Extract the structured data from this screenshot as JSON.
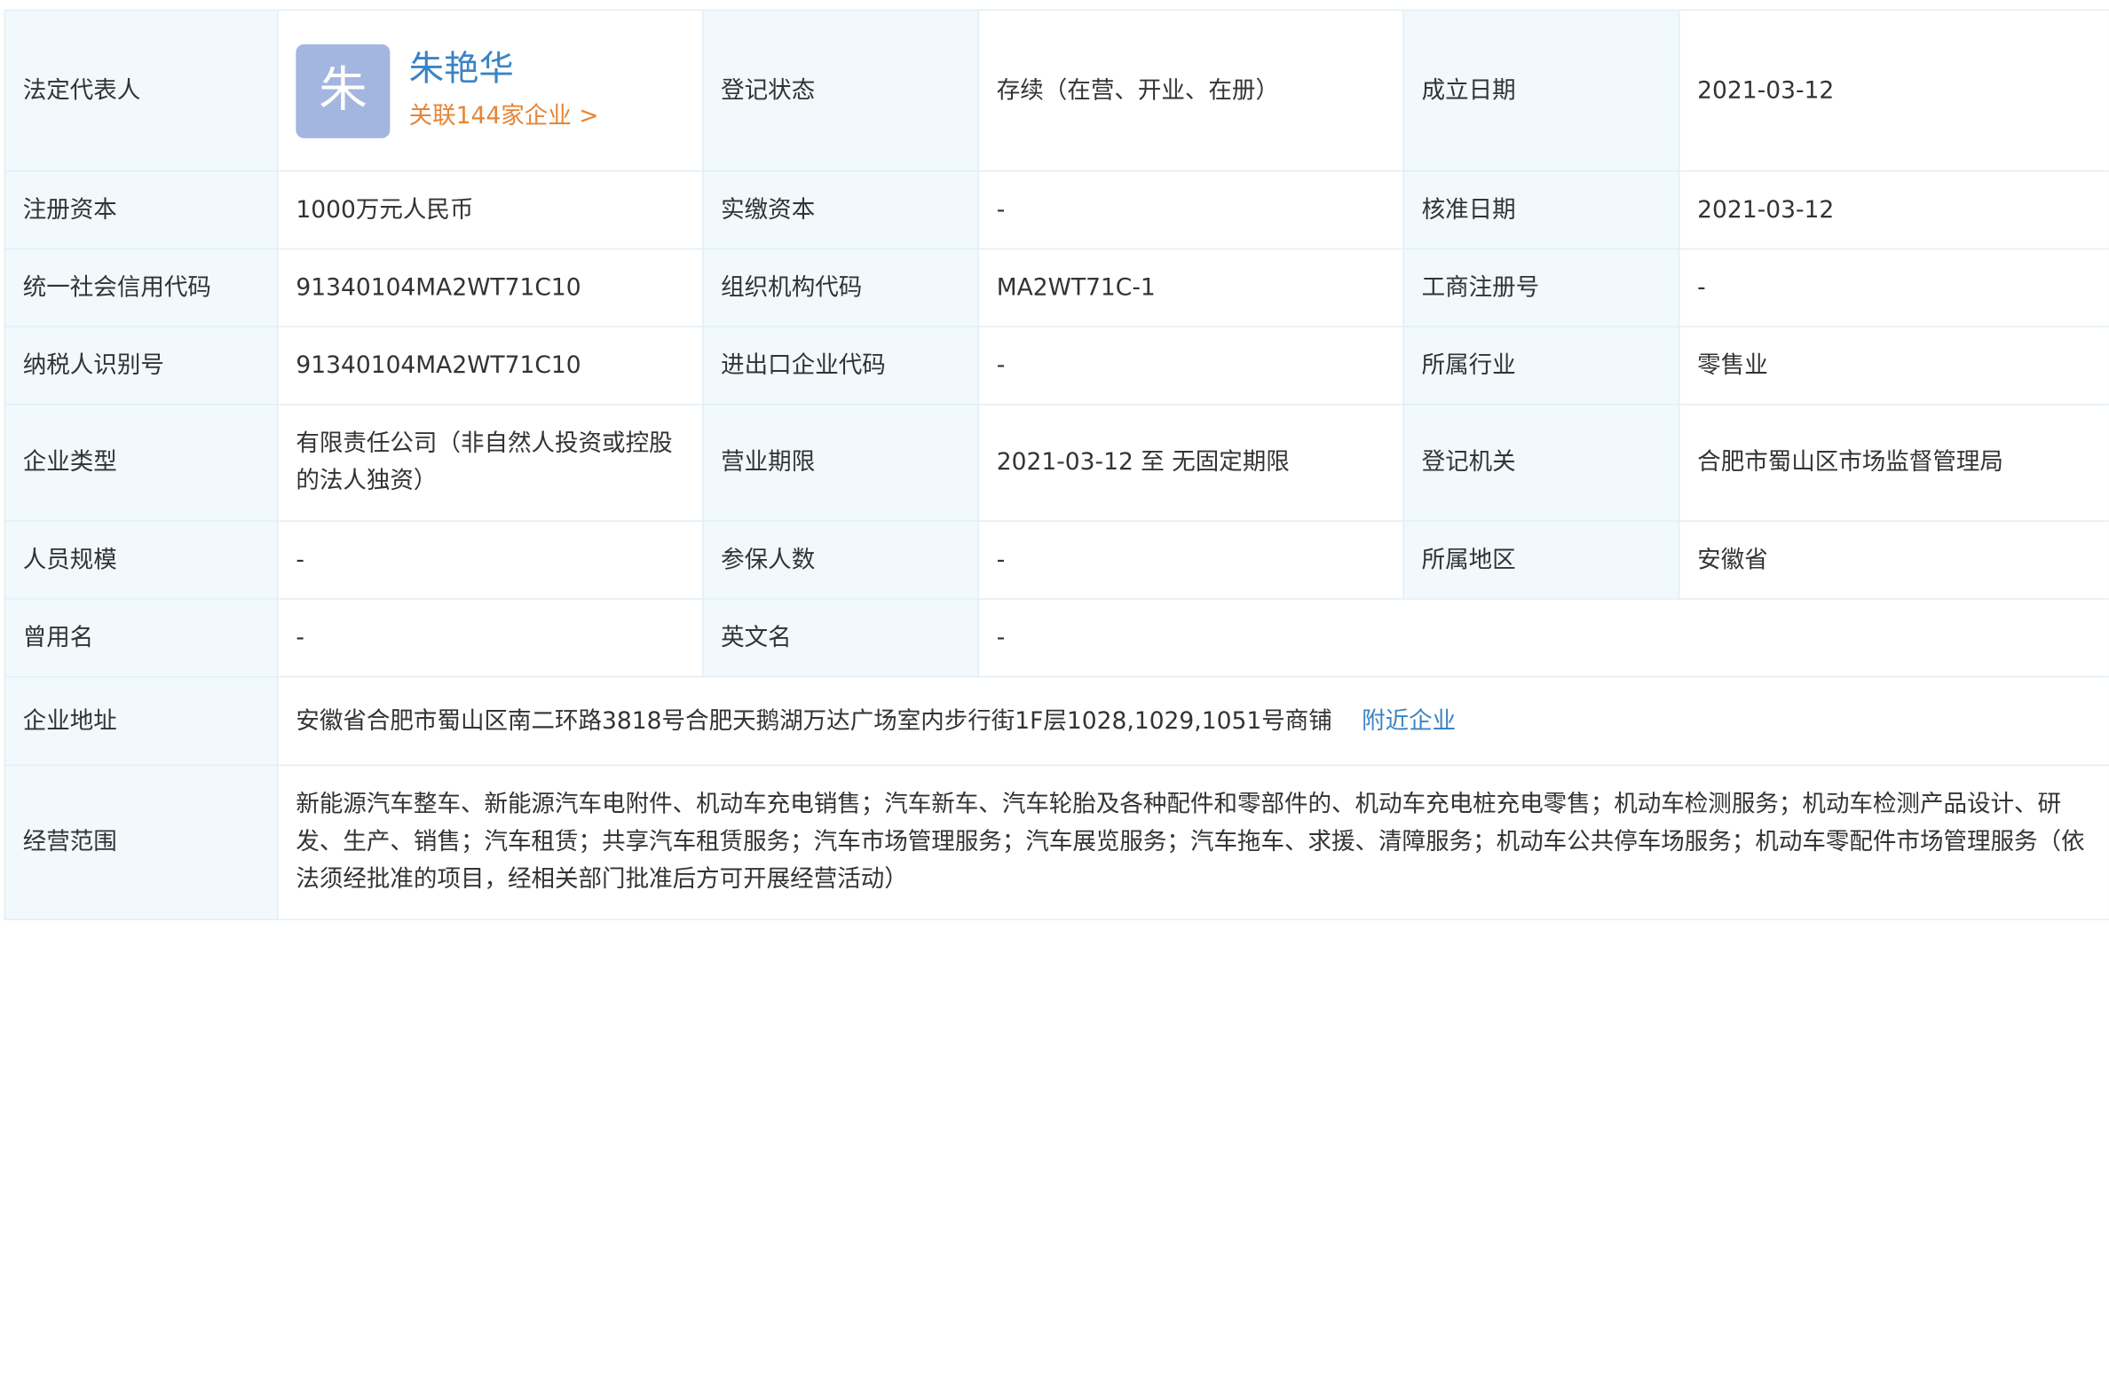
{
  "legal_rep": {
    "label": "法定代表人",
    "avatar_char": "朱",
    "name": "朱艳华",
    "related_link": "关联144家企业 >",
    "avatar_color": "#a3b6e0",
    "name_color": "#3a84c5",
    "link_color": "#e68536"
  },
  "reg_status": {
    "label": "登记状态",
    "value": "存续（在营、开业、在册）"
  },
  "founded": {
    "label": "成立日期",
    "value": "2021-03-12"
  },
  "reg_capital": {
    "label": "注册资本",
    "value": "1000万元人民币"
  },
  "paid_capital": {
    "label": "实缴资本",
    "value": "-"
  },
  "approval_date": {
    "label": "核准日期",
    "value": "2021-03-12"
  },
  "credit_code": {
    "label": "统一社会信用代码",
    "value": "91340104MA2WT71C10"
  },
  "org_code": {
    "label": "组织机构代码",
    "value": "MA2WT71C-1"
  },
  "biz_reg_no": {
    "label": "工商注册号",
    "value": "-"
  },
  "taxpayer_id": {
    "label": "纳税人识别号",
    "value": "91340104MA2WT71C10"
  },
  "import_export_code": {
    "label": "进出口企业代码",
    "value": "-"
  },
  "industry": {
    "label": "所属行业",
    "value": "零售业"
  },
  "company_type": {
    "label": "企业类型",
    "value": "有限责任公司（非自然人投资或控股的法人独资）"
  },
  "business_term": {
    "label": "营业期限",
    "value": "2021-03-12 至 无固定期限"
  },
  "reg_authority": {
    "label": "登记机关",
    "value": "合肥市蜀山区市场监督管理局"
  },
  "staff_size": {
    "label": "人员规模",
    "value": "-"
  },
  "insured_count": {
    "label": "参保人数",
    "value": "-"
  },
  "region": {
    "label": "所属地区",
    "value": "安徽省"
  },
  "former_name": {
    "label": "曾用名",
    "value": "-"
  },
  "english_name": {
    "label": "英文名",
    "value": "-"
  },
  "address": {
    "label": "企业地址",
    "value": "安徽省合肥市蜀山区南二环路3818号合肥天鹅湖万达广场室内步行街1F层1028,1029,1051号商铺",
    "nearby_link": "附近企业"
  },
  "business_scope": {
    "label": "经营范围",
    "value": "新能源汽车整车、新能源汽车电附件、机动车充电销售；汽车新车、汽车轮胎及各种配件和零部件的、机动车充电桩充电零售；机动车检测服务；机动车检测产品设计、研发、生产、销售；汽车租赁；共享汽车租赁服务；汽车市场管理服务；汽车展览服务；汽车拖车、求援、清障服务；机动车公共停车场服务；机动车零配件市场管理服务（依法须经批准的项目，经相关部门批准后方可开展经营活动）"
  },
  "theme": {
    "label_bg": "#f1f9fc",
    "border": "#e4eef5",
    "text": "#333333"
  }
}
